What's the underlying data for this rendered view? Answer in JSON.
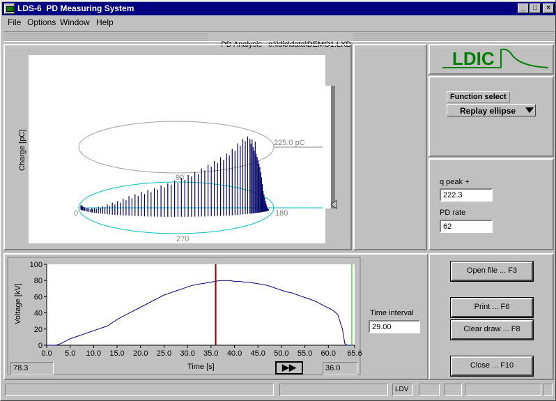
{
  "window": {
    "title": "LDS-6  PD Measuring System",
    "minimize": "_",
    "maximize": "□",
    "close": "×"
  },
  "menu": [
    "File",
    "Options",
    "Window",
    "Help"
  ],
  "header": {
    "mode": "PD Analysis",
    "file": "c:\\ldic\\data\\DEMO1.LXD"
  },
  "logo": {
    "text": "LDIC",
    "color": "#008000"
  },
  "function_select": {
    "label": "Function select",
    "value": "Replay ellipse"
  },
  "readings": {
    "q_peak_label": "q peak +",
    "q_peak_value": "222.3",
    "pd_rate_label": "PD rate",
    "pd_rate_value": "62"
  },
  "ellipse_plot": {
    "ylabel": "Charge [pC]",
    "upper_value": "225.0 pC",
    "angle_0": "0",
    "angle_90": "90",
    "angle_180": "180",
    "angle_270": "270",
    "ellipse_color": "#00c0c0",
    "bar_color": "#000060",
    "pulses": [
      [
        12,
        14
      ],
      [
        13,
        13
      ],
      [
        15,
        12
      ],
      [
        16,
        11
      ],
      [
        18,
        11
      ],
      [
        20,
        10
      ],
      [
        22,
        9
      ],
      [
        24,
        9
      ],
      [
        26,
        10
      ],
      [
        28,
        8
      ],
      [
        30,
        12
      ],
      [
        31,
        10
      ],
      [
        33,
        14
      ],
      [
        35,
        12
      ],
      [
        37,
        18
      ],
      [
        39,
        16
      ],
      [
        41,
        22
      ],
      [
        43,
        20
      ],
      [
        45,
        28
      ],
      [
        47,
        24
      ],
      [
        49,
        34
      ],
      [
        51,
        30
      ],
      [
        53,
        40
      ],
      [
        55,
        36
      ],
      [
        57,
        48
      ],
      [
        59,
        44
      ],
      [
        61,
        56
      ],
      [
        63,
        50
      ],
      [
        65,
        62
      ],
      [
        67,
        58
      ],
      [
        69,
        70
      ],
      [
        71,
        64
      ],
      [
        73,
        76
      ],
      [
        75,
        70
      ],
      [
        77,
        82
      ],
      [
        79,
        78
      ],
      [
        81,
        90
      ],
      [
        83,
        84
      ],
      [
        85,
        96
      ],
      [
        87,
        92
      ],
      [
        89,
        104
      ],
      [
        91,
        98
      ],
      [
        93,
        112
      ],
      [
        95,
        106
      ],
      [
        97,
        120
      ],
      [
        99,
        116
      ],
      [
        101,
        128
      ],
      [
        103,
        122
      ],
      [
        105,
        138
      ],
      [
        107,
        132
      ],
      [
        109,
        148
      ],
      [
        111,
        142
      ],
      [
        113,
        158
      ],
      [
        115,
        152
      ],
      [
        117,
        168
      ],
      [
        119,
        160
      ],
      [
        121,
        178
      ],
      [
        123,
        172
      ],
      [
        125,
        190
      ],
      [
        127,
        184
      ],
      [
        129,
        205
      ],
      [
        131,
        198
      ],
      [
        133,
        216
      ],
      [
        135,
        210
      ],
      [
        137,
        222
      ],
      [
        139,
        215
      ],
      [
        140,
        200
      ],
      [
        141,
        212
      ],
      [
        142,
        190
      ],
      [
        143,
        180
      ],
      [
        144,
        205
      ],
      [
        145,
        170
      ],
      [
        146,
        160
      ],
      [
        147,
        150
      ],
      [
        148,
        140
      ],
      [
        149,
        130
      ],
      [
        150,
        115
      ],
      [
        151,
        100
      ],
      [
        152,
        80
      ],
      [
        153,
        60
      ],
      [
        154,
        50
      ],
      [
        155,
        40
      ],
      [
        156,
        30
      ],
      [
        157,
        22
      ],
      [
        158,
        15
      ],
      [
        159,
        10
      ],
      [
        160,
        6
      ],
      [
        161,
        4
      ]
    ]
  },
  "voltage_chart": {
    "type": "line",
    "ylabel": "Voltage [kV]",
    "xlabel": "Time [s]",
    "xlim": [
      0,
      65.6
    ],
    "ylim": [
      0,
      100
    ],
    "xticks": [
      "0.0",
      "5.0",
      "10.0",
      "15.0",
      "20.0",
      "25.0",
      "30.0",
      "35.0",
      "40.0",
      "45.0",
      "50.0",
      "55.0",
      "60.0",
      "65.6"
    ],
    "yticks": [
      "0",
      "20",
      "40",
      "60",
      "80",
      "100"
    ],
    "line_color": "#000080",
    "cursor_red_x": 36.0,
    "cursor_green_x": 65.0,
    "readout_left": "78.3",
    "readout_right": "36.0",
    "play_glyph": "▶▶"
  },
  "chart_data": {
    "type": "line",
    "xlabel": "Time [s]",
    "ylabel": "Voltage [kV]",
    "xlim": [
      0,
      65.6
    ],
    "ylim": [
      0,
      100
    ],
    "x": [
      0,
      1,
      2,
      3,
      4,
      5,
      6,
      7,
      8,
      9,
      10,
      11,
      12,
      13,
      14,
      15,
      16,
      17,
      18,
      19,
      20,
      21,
      22,
      23,
      24,
      25,
      26,
      27,
      28,
      29,
      30,
      31,
      32,
      33,
      34,
      35,
      36,
      37,
      38,
      39,
      40,
      41,
      42,
      43,
      44,
      45,
      46,
      47,
      48,
      49,
      50,
      51,
      52,
      53,
      54,
      55,
      56,
      57,
      58,
      59,
      60,
      61,
      62,
      63,
      63.5,
      64,
      64.5,
      65
    ],
    "series": [
      {
        "values": [
          0,
          0,
          0,
          2,
          5,
          8,
          10,
          12,
          14,
          16,
          18,
          20,
          22,
          24,
          28,
          32,
          35,
          38,
          41,
          44,
          47,
          50,
          53,
          56,
          59,
          62,
          64,
          66,
          68,
          70,
          72,
          74,
          75,
          76,
          77,
          78,
          79,
          80,
          80,
          80,
          79,
          79,
          78,
          78,
          77,
          76,
          75,
          74,
          72,
          70,
          68,
          66,
          65,
          63,
          61,
          59,
          57,
          55,
          52,
          49,
          46,
          43,
          38,
          20,
          2,
          0,
          0,
          0
        ]
      }
    ]
  },
  "time_interval": {
    "label": "Time interval",
    "value": "29.00"
  },
  "buttons": {
    "open": "Open file ... F3",
    "print": "Print ... F6",
    "clear": "Clear draw ... F8",
    "close": "Close ... F10"
  },
  "status": {
    "ldv": "LDV"
  }
}
